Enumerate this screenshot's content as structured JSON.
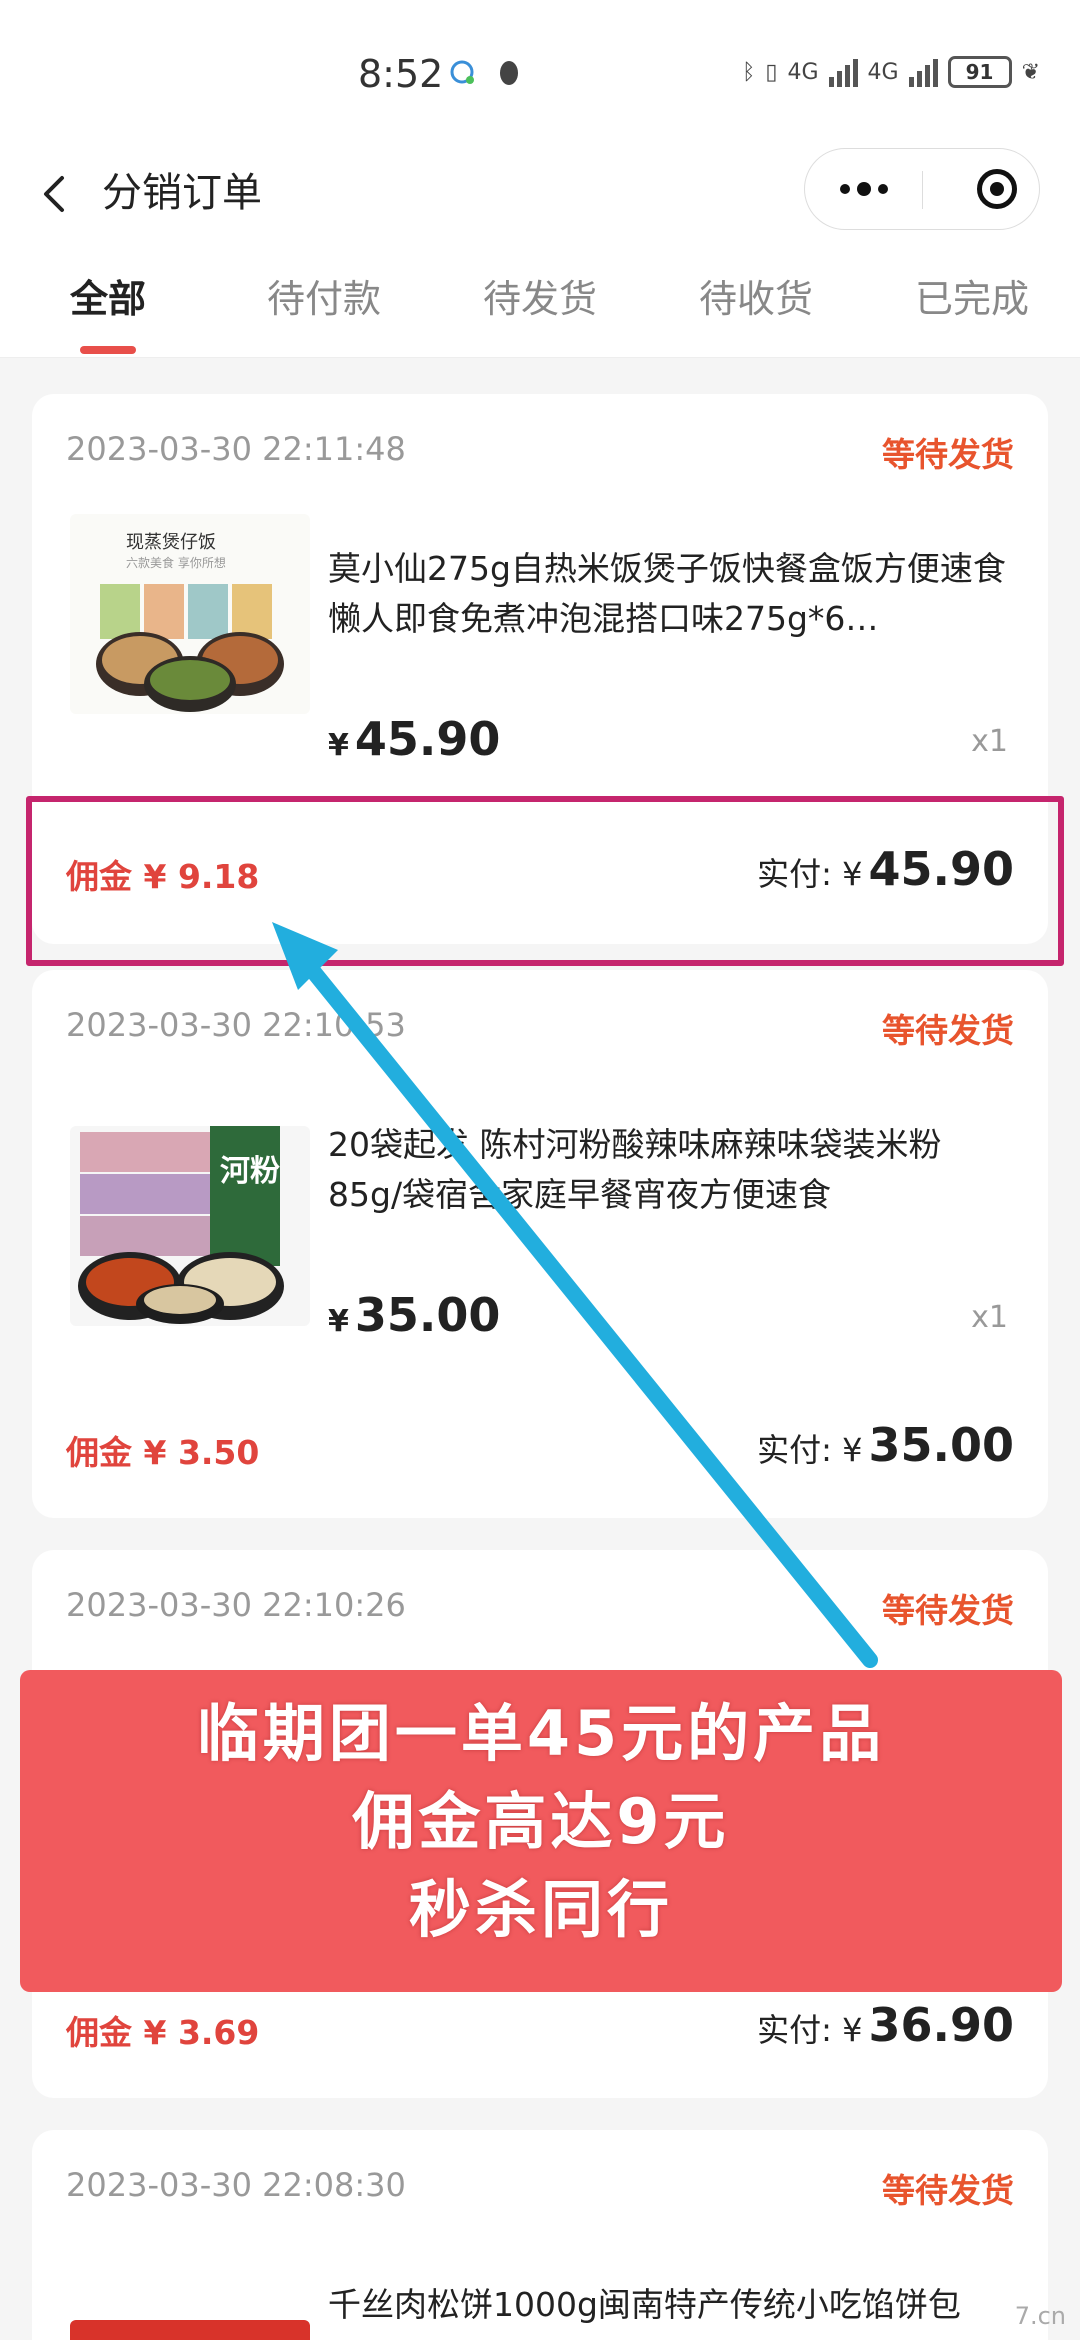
{
  "status_bar": {
    "time": "8:52",
    "network1": "4G",
    "network2": "4G",
    "battery": "91"
  },
  "nav": {
    "title": "分销订单"
  },
  "tabs": [
    "全部",
    "待付款",
    "待发货",
    "待收货",
    "已完成"
  ],
  "orders": [
    {
      "date": "2023-03-30 22:11:48",
      "status": "等待发货",
      "image_label": "现蒸煲仔饭",
      "image_sublabel": "六款美食 享你所想",
      "name": "莫小仙275g自热米饭煲子饭快餐盒饭方便速食懒人即食免煮冲泡混搭口味275g*6…",
      "currency": "¥",
      "price": "45.90",
      "qty": "x1",
      "commission": "佣金 ¥ 9.18",
      "paid_label": "实付: ¥",
      "paid_amount": "45.90"
    },
    {
      "date": "2023-03-30 22:10:53",
      "status": "等待发货",
      "image_label": "河粉",
      "name": "20袋起发 陈村河粉酸辣味麻辣味袋装米粉85g/袋宿舍家庭早餐宵夜方便速食",
      "currency": "¥",
      "price": "35.00",
      "qty": "x1",
      "commission": "佣金 ¥ 3.50",
      "paid_label": "实付: ¥",
      "paid_amount": "35.00"
    },
    {
      "date": "2023-03-30 22:10:26",
      "status": "等待发货",
      "commission": "佣金 ¥ 3.69",
      "paid_label": "实付: ¥",
      "paid_amount": "36.90"
    },
    {
      "date": "2023-03-30 22:08:30",
      "status": "等待发货",
      "name": "千丝肉松饼1000g闽南特产传统小吃馅饼包"
    }
  ],
  "promo": {
    "line1": "临期团一单45元的产品",
    "line2": "佣金高达9元",
    "line3": "秒杀同行"
  },
  "colors": {
    "accent_red": "#e84f4a",
    "status_orange": "#e8542d",
    "highlight_magenta": "#c5256d",
    "arrow_blue": "#22aede",
    "promo_red": "#f15a5d"
  },
  "watermark": "7.cn"
}
